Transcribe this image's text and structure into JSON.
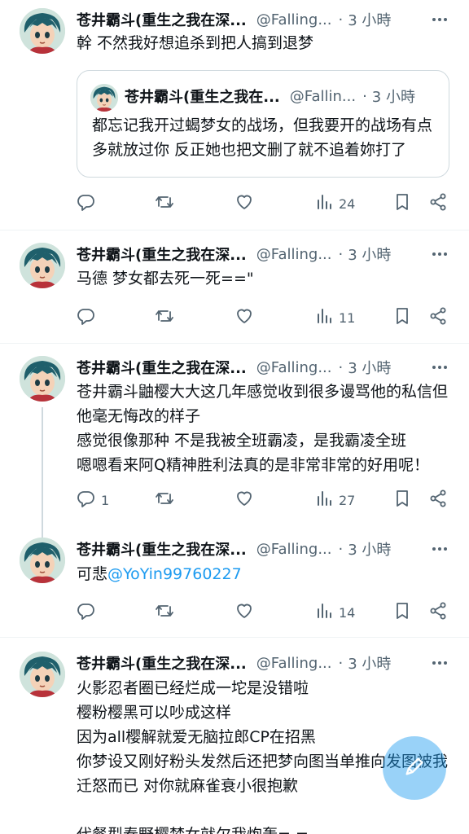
{
  "colors": {
    "accent": "#1d9bf0",
    "muted": "#536471",
    "text": "#0f1419"
  },
  "tweets": [
    {
      "name": "苍井霸斗(重生之我在深...",
      "handle": "@Falling...",
      "dot": "·",
      "time": "3 小時",
      "text": "幹 不然我好想追杀到把人搞到退梦",
      "quote": {
        "name": "苍井霸斗(重生之我在...",
        "handle": "@Fallin...",
        "dot": "·",
        "time": "3 小時",
        "text": "都忘记我开过蝎梦女的战场，但我要开的战场有点多就放过你 反正她也把文删了就不追着妳打了"
      },
      "replies": "",
      "views": "24"
    },
    {
      "name": "苍井霸斗(重生之我在深...",
      "handle": "@Falling...",
      "dot": "·",
      "time": "3 小時",
      "text": "马德 梦女都去死一死==\"",
      "replies": "",
      "views": "11"
    },
    {
      "name": "苍井霸斗(重生之我在深...",
      "handle": "@Falling...",
      "dot": "·",
      "time": "3 小時",
      "text": "苍井霸斗鼬樱大大这几年感觉收到很多谩骂他的私信但他毫无悔改的样子\n感觉很像那种 不是我被全班霸凌，是我霸凌全班\n嗯嗯看来阿Q精神胜利法真的是非常非常的好用呢！",
      "replies": "1",
      "views": "27"
    },
    {
      "name": "苍井霸斗(重生之我在深...",
      "handle": "@Falling...",
      "dot": "·",
      "time": "3 小時",
      "text_prefix": "可悲",
      "mention": "@YoYin99760227",
      "replies": "",
      "views": "14"
    },
    {
      "name": "苍井霸斗(重生之我在深...",
      "handle": "@Falling...",
      "dot": "·",
      "time": "3 小時",
      "text": "火影忍者圈已经烂成一坨是没错啦\n樱粉樱黑可以吵成这样\n因为all樱解就爱无脑拉郎CP在招黑\n你梦设又刚好粉头发然后还把梦向图当单推向发图被我迁怒而已 对你就麻雀衰小很抱歉\n\n代餐型春野樱梦女就欠我炮轰= ="
    }
  ],
  "icons": [
    "more-icon",
    "reply-icon",
    "retweet-icon",
    "like-icon",
    "views-icon",
    "bookmark-icon",
    "share-icon",
    "compose-icon"
  ]
}
